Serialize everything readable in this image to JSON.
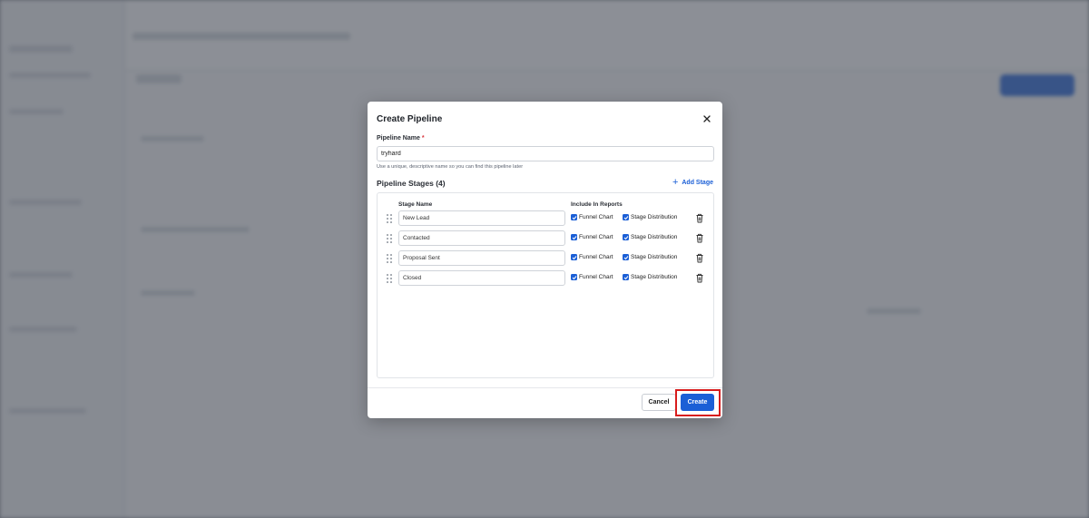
{
  "modal": {
    "title": "Create Pipeline",
    "close_label": "×",
    "pipeline_name_label": "Pipeline Name",
    "required_mark": "*",
    "pipeline_name_value": "tryhard",
    "help_text": "Use a unique, descriptive name so you can find this pipeline later",
    "stages_title": "Pipeline Stages (4)",
    "add_stage_label": "Add Stage",
    "columns": {
      "stage_name": "Stage Name",
      "include_in_reports": "Include In Reports"
    },
    "stages": [
      {
        "name": "New Lead",
        "funnel_label": "Funnel Chart",
        "funnel_checked": true,
        "dist_label": "Stage Distribution",
        "dist_checked": true
      },
      {
        "name": "Contacted",
        "funnel_label": "Funnel Chart",
        "funnel_checked": true,
        "dist_label": "Stage Distribution",
        "dist_checked": true
      },
      {
        "name": "Proposal Sent",
        "funnel_label": "Funnel Chart",
        "funnel_checked": true,
        "dist_label": "Stage Distribution",
        "dist_checked": true
      },
      {
        "name": "Closed",
        "funnel_label": "Funnel Chart",
        "funnel_checked": true,
        "dist_label": "Stage Distribution",
        "dist_checked": true
      }
    ],
    "cancel_label": "Cancel",
    "create_label": "Create"
  },
  "colors": {
    "primary": "#1b5fd6",
    "highlight": "#d81d1d",
    "required": "#d9373e"
  },
  "icons": {
    "close": "close-icon",
    "add": "plus-icon",
    "drag": "drag-handle-icon",
    "delete": "trash-icon",
    "checkbox": "checkmark-icon"
  }
}
